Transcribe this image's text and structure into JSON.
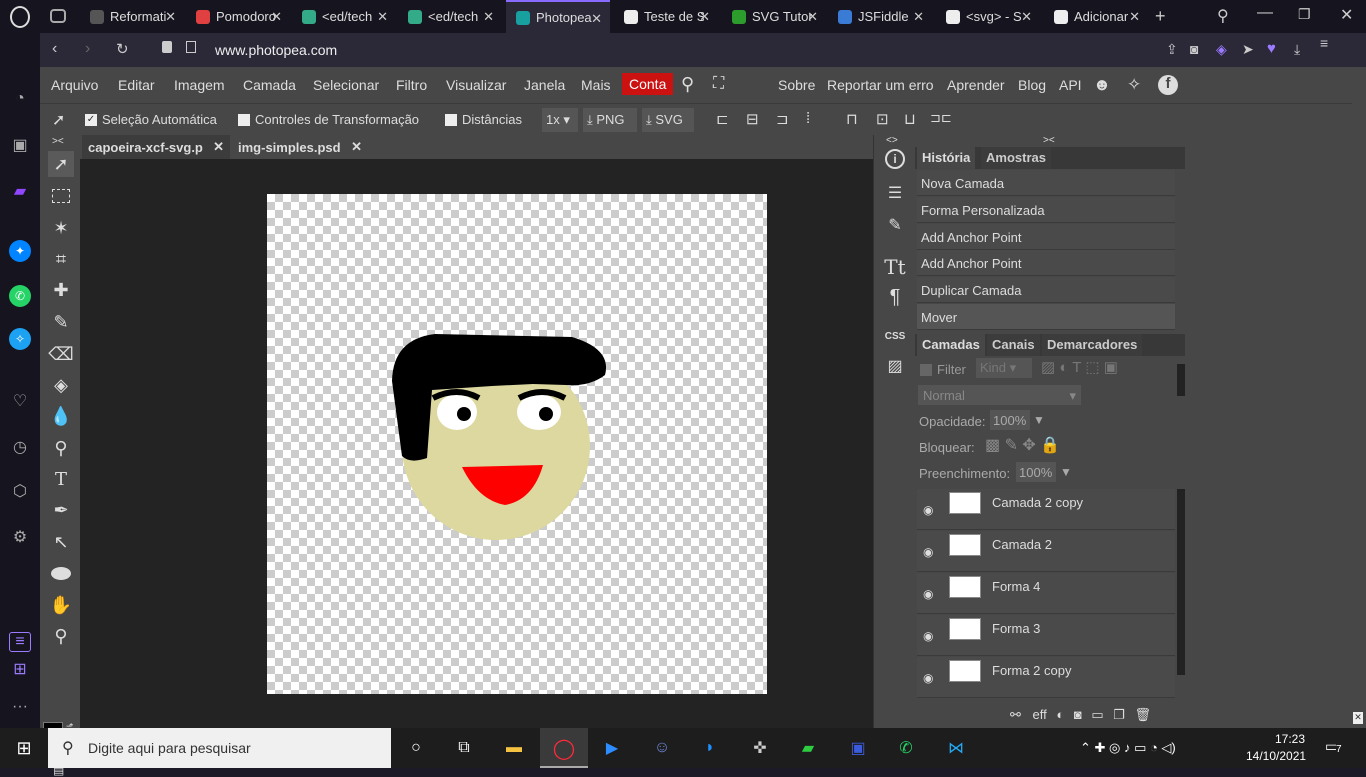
{
  "browser": {
    "tabs": [
      {
        "title": "Reformati",
        "color": "#555"
      },
      {
        "title": "Pomodoro",
        "color": "#e04040"
      },
      {
        "title": "<ed/tech",
        "color": "#3a8"
      },
      {
        "title": "<ed/tech",
        "color": "#3a8"
      },
      {
        "title": "Photopea",
        "color": "#18a0a0"
      },
      {
        "title": "Teste de S",
        "color": "#eee"
      },
      {
        "title": "SVG Tutor",
        "color": "#2c9c2c"
      },
      {
        "title": "JSFiddle",
        "color": "#3a7bd5"
      },
      {
        "title": "<svg> - S",
        "color": "#eee"
      },
      {
        "title": "Adicionar",
        "color": "#eee"
      }
    ],
    "url": "www.photopea.com"
  },
  "menu": {
    "items": [
      "Arquivo",
      "Editar",
      "Imagem",
      "Camada",
      "Selecionar",
      "Filtro",
      "Visualizar",
      "Janela",
      "Mais"
    ],
    "account": "Conta",
    "right_items": [
      "Sobre",
      "Reportar um erro",
      "Aprender",
      "Blog",
      "API"
    ]
  },
  "options": {
    "auto_select": "Seleção Automática",
    "transform_controls": "Controles de Transformação",
    "distances": "Distâncias",
    "zoom": "1x",
    "png": "PNG",
    "svg": "SVG"
  },
  "documents": {
    "tabs": [
      "capoeira-xcf-svg.p",
      "img-simples.psd"
    ]
  },
  "colors": {
    "foreground": "#000000",
    "background": "#ff0000",
    "account": "#cc1111",
    "face": "#dcd8a0",
    "mouth": "#ff0000"
  },
  "history": {
    "tabs": [
      "História",
      "Amostras"
    ],
    "items": [
      "Nova Camada",
      "Forma Personalizada",
      "Add Anchor Point",
      "Add Anchor Point",
      "Duplicar Camada",
      "Mover"
    ]
  },
  "layers": {
    "tabs": [
      "Camadas",
      "Canais",
      "Demarcadores"
    ],
    "filter": "Filter",
    "kind": "Kind",
    "blend": "Normal",
    "opacity_label": "Opacidade:",
    "opacity": "100%",
    "lock_label": "Bloquear:",
    "fill_label": "Preenchimento:",
    "fill": "100%",
    "items": [
      "Camada 2 copy",
      "Camada 2",
      "Forma 4",
      "Forma 3",
      "Forma 2 copy"
    ],
    "footer_eff": "eff"
  },
  "midstrip": {
    "css": "CSS"
  },
  "taskbar": {
    "search_placeholder": "Digite aqui para pesquisar",
    "time": "17:23",
    "date": "14/10/2021",
    "notifications": "7"
  }
}
